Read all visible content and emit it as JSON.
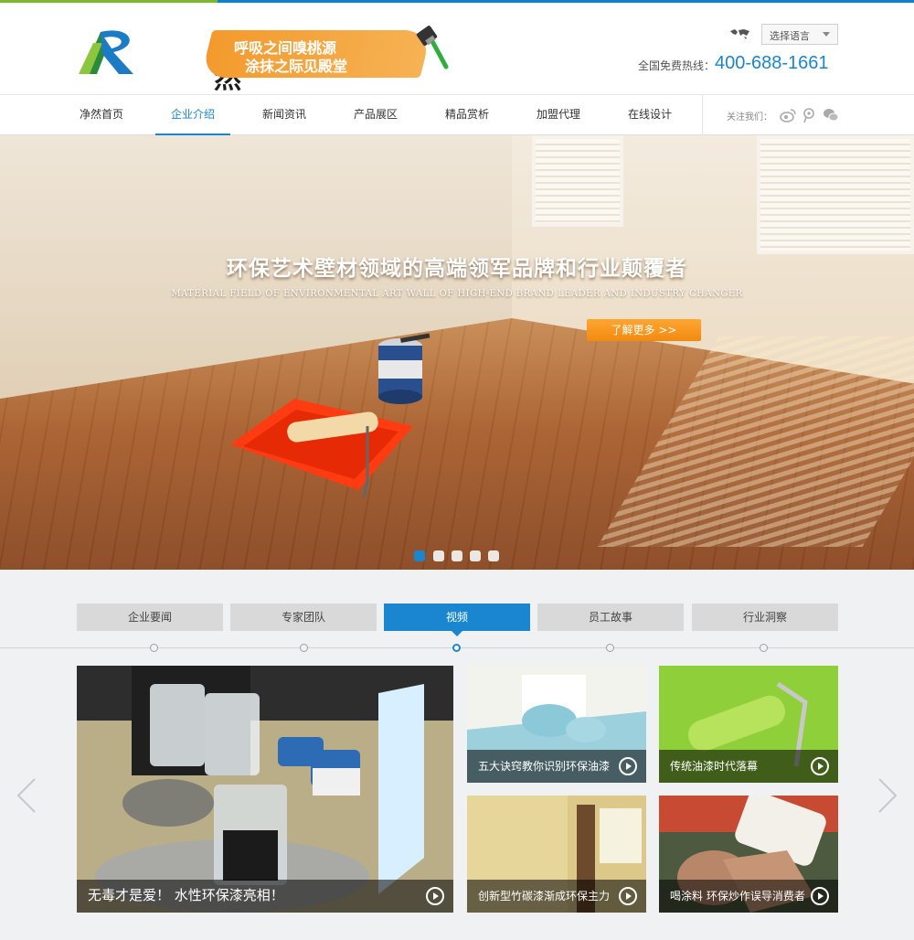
{
  "brand": {
    "logo_letter": "R",
    "logo_text": "净然",
    "slogan_line1": "呼吸之间嗅桃源",
    "slogan_line2": "涂抹之际见殿堂"
  },
  "header": {
    "language_select": "选择语言",
    "hotline_label": "全国免费热线：",
    "hotline_number": "400-688-1661"
  },
  "nav": {
    "items": [
      {
        "label": "净然首页"
      },
      {
        "label": "企业介绍"
      },
      {
        "label": "新闻资讯"
      },
      {
        "label": "产品展区"
      },
      {
        "label": "精品赏析"
      },
      {
        "label": "加盟代理"
      },
      {
        "label": "在线设计"
      }
    ],
    "active_index": 1,
    "follow_label": "关注我们：",
    "social_icons": [
      "weibo-icon",
      "tencent-weibo-icon",
      "wechat-icon"
    ]
  },
  "hero": {
    "title": "环保艺术壁材领域的高端领军品牌和行业颠覆者",
    "subtitle": "MATERIAL FIELD OF ENVIRONMENTAL ART WALL OF HIGH-END BRAND LEADER AND INDUSTRY CHANGER",
    "cta_label": "了解更多 >>",
    "slide_count": 5,
    "active_slide": 1
  },
  "tabs": {
    "items": [
      {
        "label": "企业要闻"
      },
      {
        "label": "专家团队"
      },
      {
        "label": "视频"
      },
      {
        "label": "员工故事"
      },
      {
        "label": "行业洞察"
      }
    ],
    "active_index": 2
  },
  "videos": {
    "featured": {
      "caption": "无毒才是爱！ 水性环保漆亮相！"
    },
    "items": [
      {
        "caption": "五大诀窍教你识别环保油漆"
      },
      {
        "caption": "传统油漆时代落幕"
      },
      {
        "caption": "创新型竹碳漆渐成环保主力"
      },
      {
        "caption": "喝涂料 环保炒作误导消费者"
      }
    ]
  },
  "colors": {
    "accent": "#1a86d0",
    "brand_green": "#79b92e",
    "cta_orange": "#f28a0f"
  }
}
